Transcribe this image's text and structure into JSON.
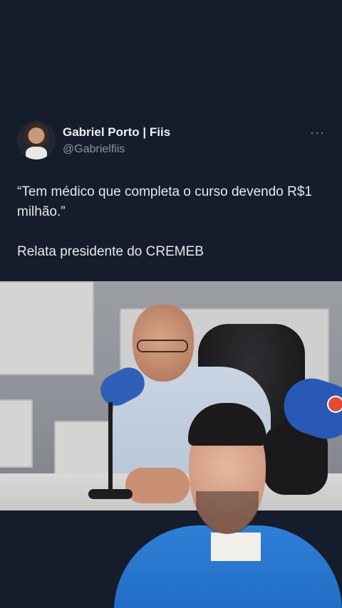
{
  "tweet": {
    "author_name": "Gabriel Porto | Fiis",
    "author_handle": "@Gabrielfiis",
    "more_label": "···",
    "quote_line": "“Tem médico que completa o curso devendo R$1 milhão.”",
    "body_line": "Relata presidente do CREMEB"
  },
  "icons": {
    "more": "more-horizontal-icon",
    "avatar": "profile-avatar"
  },
  "colors": {
    "background": "#151c2b",
    "handle": "#8b98a5",
    "text": "#e7e9ea"
  }
}
